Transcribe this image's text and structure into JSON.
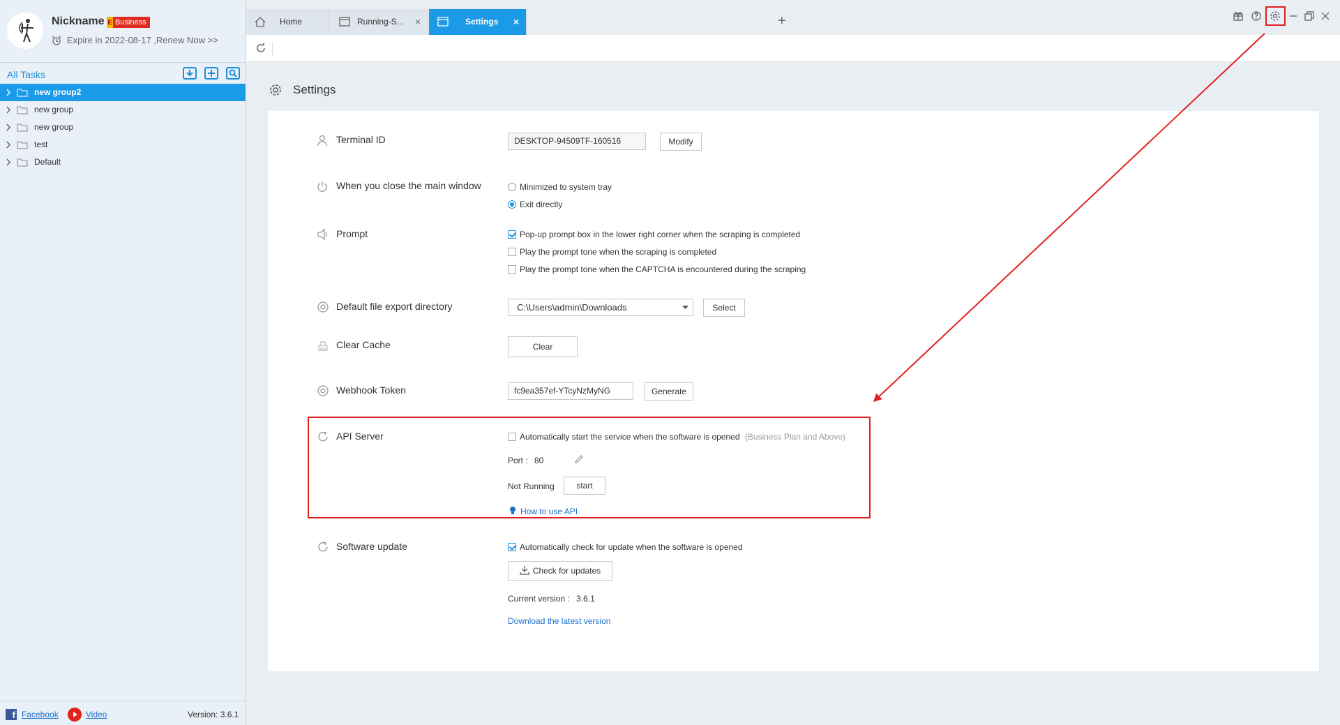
{
  "profile": {
    "nickname": "Nickname",
    "plan_badge_mark": "E",
    "plan_badge": "Business",
    "expire_text": "Expire in 2022-08-17 ,Renew Now >>"
  },
  "tasks": {
    "header": "All Tasks",
    "tree": [
      {
        "label": "new group2",
        "active": true
      },
      {
        "label": "new group",
        "active": false
      },
      {
        "label": "new group",
        "active": false
      },
      {
        "label": "test",
        "active": false
      },
      {
        "label": "Default",
        "active": false
      }
    ]
  },
  "footer": {
    "facebook_icon": "f",
    "facebook": "Facebook",
    "video": "Video",
    "version": "Version: 3.6.1"
  },
  "tabs": [
    {
      "label": "Home",
      "icon": "home-icon",
      "closable": false,
      "active": false
    },
    {
      "label": "Running-S...",
      "icon": "window-icon",
      "closable": true,
      "active": false
    },
    {
      "label": "Settings",
      "icon": "window-icon",
      "closable": true,
      "active": true
    }
  ],
  "tab_close_glyph": "×",
  "add_tab_glyph": "+",
  "page": {
    "title": "Settings"
  },
  "settings": {
    "terminal_id": {
      "label": "Terminal ID",
      "value": "DESKTOP-94509TF-160516",
      "button": "Modify"
    },
    "close_window": {
      "label": "When you close the main window",
      "options": [
        "Minimized to system tray",
        "Exit directly"
      ],
      "selected": 1
    },
    "prompt": {
      "label": "Prompt",
      "options": [
        {
          "text": "Pop-up prompt box in the lower right corner when the scraping is completed",
          "checked": true
        },
        {
          "text": "Play the prompt tone when the scraping is completed",
          "checked": false
        },
        {
          "text": "Play the prompt tone when the CAPTCHA is encountered during the scraping",
          "checked": false
        }
      ]
    },
    "export_dir": {
      "label": "Default file export directory",
      "value": "C:\\Users\\admin\\Downloads",
      "button": "Select"
    },
    "clear_cache": {
      "label": "Clear Cache",
      "button": "Clear"
    },
    "webhook": {
      "label": "Webhook Token",
      "value": "fc9ea357ef-YTcyNzMyNG",
      "button": "Generate"
    },
    "api_server": {
      "label": "API Server",
      "auto_start": "Automatically start the service when the software is opened",
      "auto_start_checked": false,
      "plan_note": "(Business Plan and Above)",
      "port_label": "Port :",
      "port_value": "80",
      "status": "Not Running",
      "start_button": "start",
      "how_to": "How to use API"
    },
    "software_update": {
      "label": "Software update",
      "auto_check": "Automatically check for update when the software is opened",
      "auto_check_checked": true,
      "check_button": "Check for updates",
      "current_version_label": "Current version :",
      "current_version": "3.6.1",
      "download_link": "Download the latest version"
    }
  },
  "colors": {
    "accent": "#1b9ae8",
    "highlight": "#e02020",
    "link": "#1b6fc8"
  }
}
